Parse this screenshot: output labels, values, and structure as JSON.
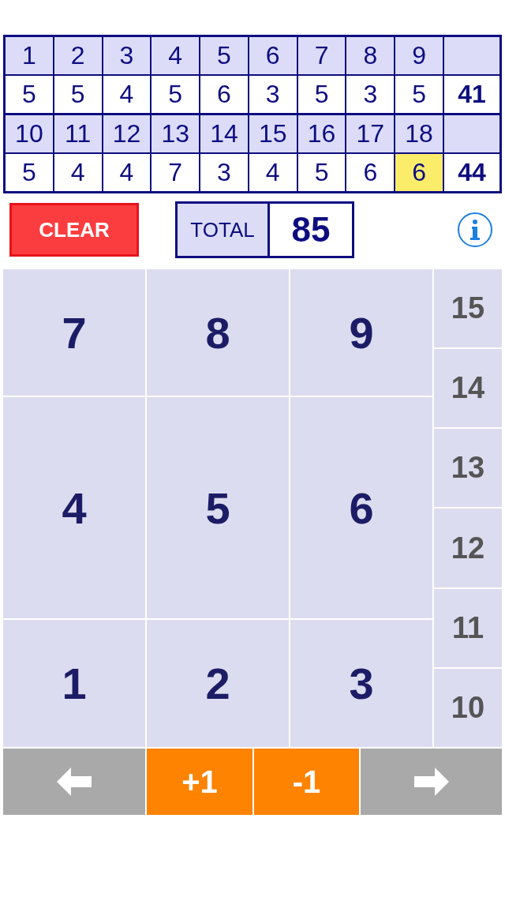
{
  "halves": [
    {
      "holes": [
        {
          "number": "1",
          "score": "5",
          "selected": false
        },
        {
          "number": "2",
          "score": "5",
          "selected": false
        },
        {
          "number": "3",
          "score": "4",
          "selected": false
        },
        {
          "number": "4",
          "score": "5",
          "selected": false
        },
        {
          "number": "5",
          "score": "6",
          "selected": false
        },
        {
          "number": "6",
          "score": "3",
          "selected": false
        },
        {
          "number": "7",
          "score": "5",
          "selected": false
        },
        {
          "number": "8",
          "score": "3",
          "selected": false
        },
        {
          "number": "9",
          "score": "5",
          "selected": false
        }
      ],
      "subtotal": "41"
    },
    {
      "holes": [
        {
          "number": "10",
          "score": "5",
          "selected": false
        },
        {
          "number": "11",
          "score": "4",
          "selected": false
        },
        {
          "number": "12",
          "score": "4",
          "selected": false
        },
        {
          "number": "13",
          "score": "7",
          "selected": false
        },
        {
          "number": "14",
          "score": "3",
          "selected": false
        },
        {
          "number": "15",
          "score": "4",
          "selected": false
        },
        {
          "number": "16",
          "score": "5",
          "selected": false
        },
        {
          "number": "17",
          "score": "6",
          "selected": false
        },
        {
          "number": "18",
          "score": "6",
          "selected": true
        }
      ],
      "subtotal": "44"
    }
  ],
  "clear_button": "CLEAR",
  "total": {
    "label": "TOTAL",
    "value": "85"
  },
  "keypad": {
    "rows": [
      [
        "7",
        "8",
        "9"
      ],
      [
        "4",
        "5",
        "6"
      ],
      [
        "1",
        "2",
        "3"
      ]
    ],
    "side_keys": [
      "15",
      "14",
      "13",
      "12",
      "11",
      "10"
    ]
  },
  "bottom_bar": {
    "increment": "+1",
    "decrement": "-1"
  }
}
